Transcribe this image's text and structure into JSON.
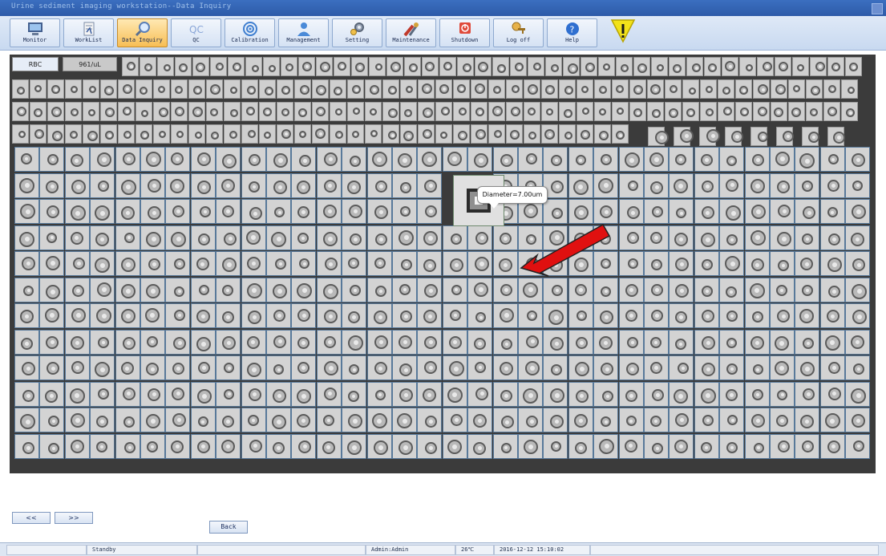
{
  "window": {
    "title": "Urine sediment imaging workstation--Data Inquiry"
  },
  "toolbar": {
    "buttons": [
      {
        "label": "Monitor"
      },
      {
        "label": "WorkList"
      },
      {
        "label": "Data Inquiry",
        "active": true
      },
      {
        "label": "QC"
      },
      {
        "label": "Calibration"
      },
      {
        "label": "Management"
      },
      {
        "label": "Setting"
      },
      {
        "label": "Maintenance"
      },
      {
        "label": "Shutdown"
      },
      {
        "label": "Log off"
      },
      {
        "label": "Help"
      }
    ],
    "qc_icon_text": "QC"
  },
  "tabs": {
    "category": "RBC",
    "count": "961/uL"
  },
  "tooltip": {
    "text": "Diameter=7.00um"
  },
  "nav": {
    "prev": "<<",
    "next": ">>",
    "back": "Back"
  },
  "status": {
    "state": "Standby",
    "user": "Admin:Admin",
    "temperature": "26℃",
    "datetime": "2016-12-12 15:10:02"
  },
  "colors": {
    "toolbar_bg": "#c8d9f0",
    "active_button": "#f7be55",
    "panel_bg": "#3b3b3b",
    "grid_line": "#58799a",
    "arrow": "#e01010",
    "warning": "#f2e21a"
  }
}
